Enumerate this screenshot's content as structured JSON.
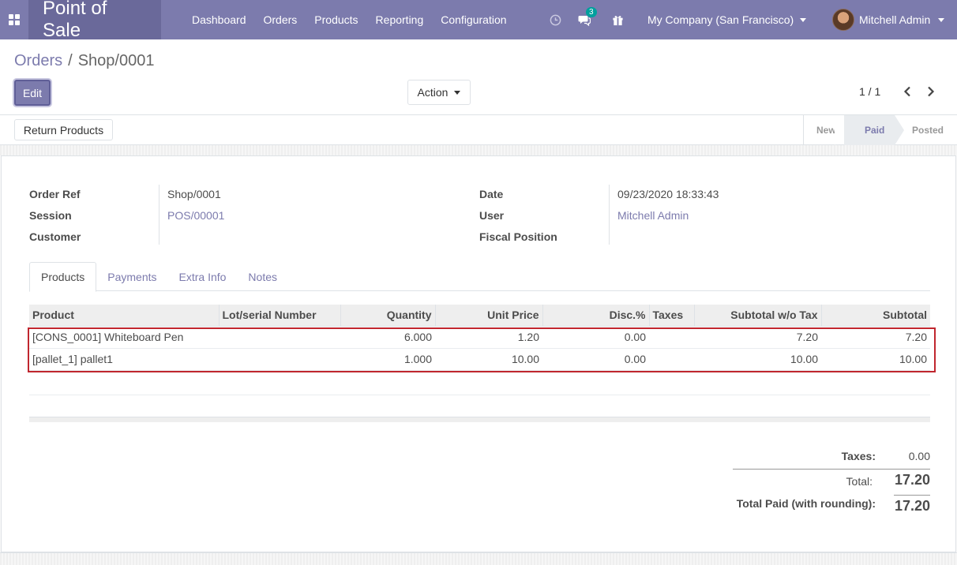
{
  "navbar": {
    "app_title": "Point of Sale",
    "menu": [
      "Dashboard",
      "Orders",
      "Products",
      "Reporting",
      "Configuration"
    ],
    "chat_badge": "3",
    "company": "My Company (San Francisco)",
    "user": "Mitchell Admin"
  },
  "breadcrumb": {
    "parent": "Orders",
    "separator": "/",
    "current": "Shop/0001"
  },
  "buttons": {
    "edit": "Edit",
    "action": "Action",
    "return_products": "Return Products"
  },
  "pager": {
    "text": "1 / 1"
  },
  "stages": [
    "New",
    "Paid",
    "Posted"
  ],
  "active_stage": "Paid",
  "fields": {
    "order_ref_label": "Order Ref",
    "order_ref": "Shop/0001",
    "session_label": "Session",
    "session": "POS/00001",
    "customer_label": "Customer",
    "customer": "",
    "date_label": "Date",
    "date": "09/23/2020 18:33:43",
    "user_label": "User",
    "user": "Mitchell Admin",
    "fiscal_label": "Fiscal Position",
    "fiscal": ""
  },
  "tabs": [
    "Products",
    "Payments",
    "Extra Info",
    "Notes"
  ],
  "table": {
    "headers": [
      "Product",
      "Lot/serial Number",
      "Quantity",
      "Unit Price",
      "Disc.%",
      "Taxes",
      "Subtotal w/o Tax",
      "Subtotal"
    ],
    "rows": [
      [
        "[CONS_0001] Whiteboard Pen",
        "",
        "6.000",
        "1.20",
        "0.00",
        "",
        "7.20",
        "7.20"
      ],
      [
        "[pallet_1] pallet1",
        "",
        "1.000",
        "10.00",
        "0.00",
        "",
        "10.00",
        "10.00"
      ]
    ]
  },
  "totals": {
    "taxes_label": "Taxes:",
    "taxes": "0.00",
    "total_label": "Total:",
    "total": "17.20",
    "paid_label": "Total Paid (with rounding):",
    "paid": "17.20"
  },
  "colors": {
    "brand": "#7c7bad",
    "brand_dark": "#6a699a",
    "highlight": "#c0262e",
    "badge": "#00a09d"
  }
}
